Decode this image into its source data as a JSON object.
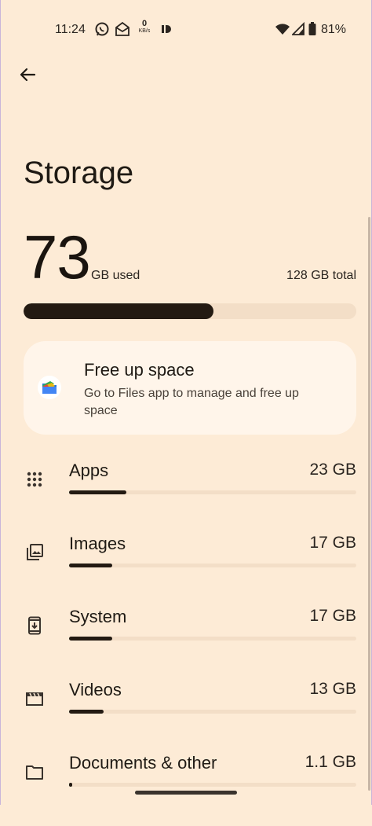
{
  "status_bar": {
    "time": "11:24",
    "netspeed_value": "0",
    "netspeed_unit": "KB/s",
    "battery": "81%"
  },
  "page": {
    "title": "Storage"
  },
  "usage": {
    "used_value": "73",
    "used_unit": "GB used",
    "total": "128 GB total",
    "used_fraction": 0.57
  },
  "free_up": {
    "title": "Free up space",
    "subtitle": "Go to Files app to manage and free up space"
  },
  "categories": [
    {
      "label": "Apps",
      "size": "23 GB",
      "fraction": 0.2,
      "icon": "apps-grid-icon"
    },
    {
      "label": "Images",
      "size": "17 GB",
      "fraction": 0.15,
      "icon": "images-icon"
    },
    {
      "label": "System",
      "size": "17 GB",
      "fraction": 0.15,
      "icon": "system-update-icon"
    },
    {
      "label": "Videos",
      "size": "13 GB",
      "fraction": 0.12,
      "icon": "movie-clapper-icon"
    },
    {
      "label": "Documents & other",
      "size": "1.1 GB",
      "fraction": 0.01,
      "icon": "folder-icon"
    }
  ],
  "colors": {
    "background": "#fdebd6",
    "accent": "#231a12",
    "track": "#f3dec7",
    "card": "#fff5ea"
  }
}
